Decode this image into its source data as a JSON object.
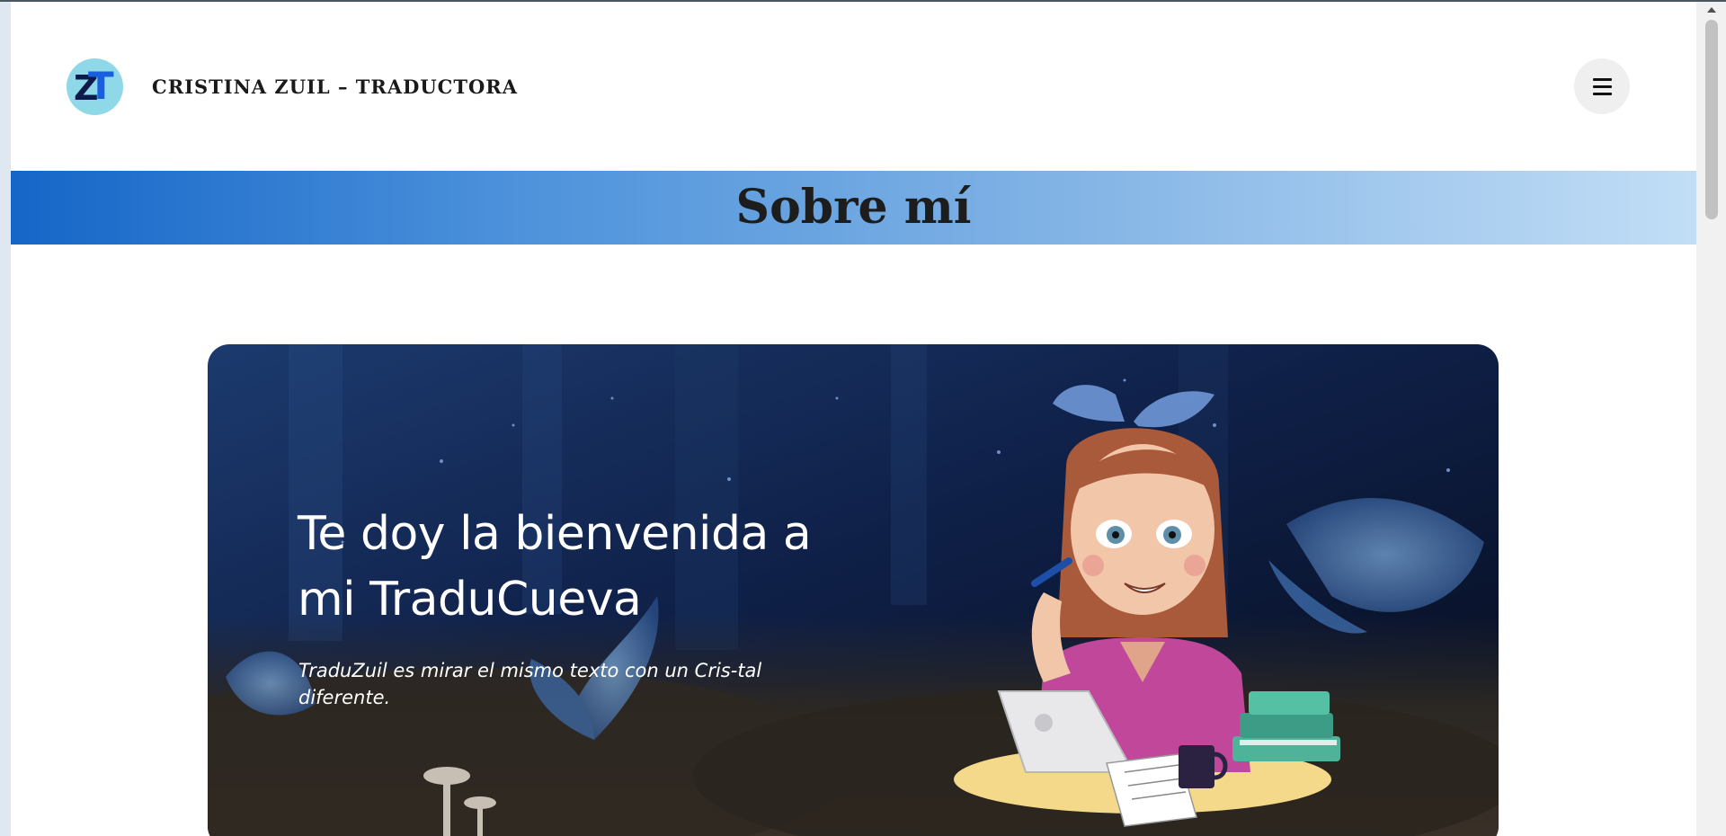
{
  "header": {
    "logo_text": "ZT",
    "site_title": "CRISTINA ZUIL – TRADUCTORA",
    "menu_icon": "hamburger-menu-icon"
  },
  "banner": {
    "title": "Sobre mí"
  },
  "hero": {
    "heading": "Te doy la bienvenida a mi TraduCueva",
    "subtitle": "TraduZuil es mirar el mismo texto con un Cris-tal diferente."
  },
  "colors": {
    "banner_start": "#1566c8",
    "banner_end": "#c2def6",
    "hero_dark": "#0a1228",
    "logo_circle": "#8ed8e8",
    "logo_accent": "#1a5ee0"
  }
}
